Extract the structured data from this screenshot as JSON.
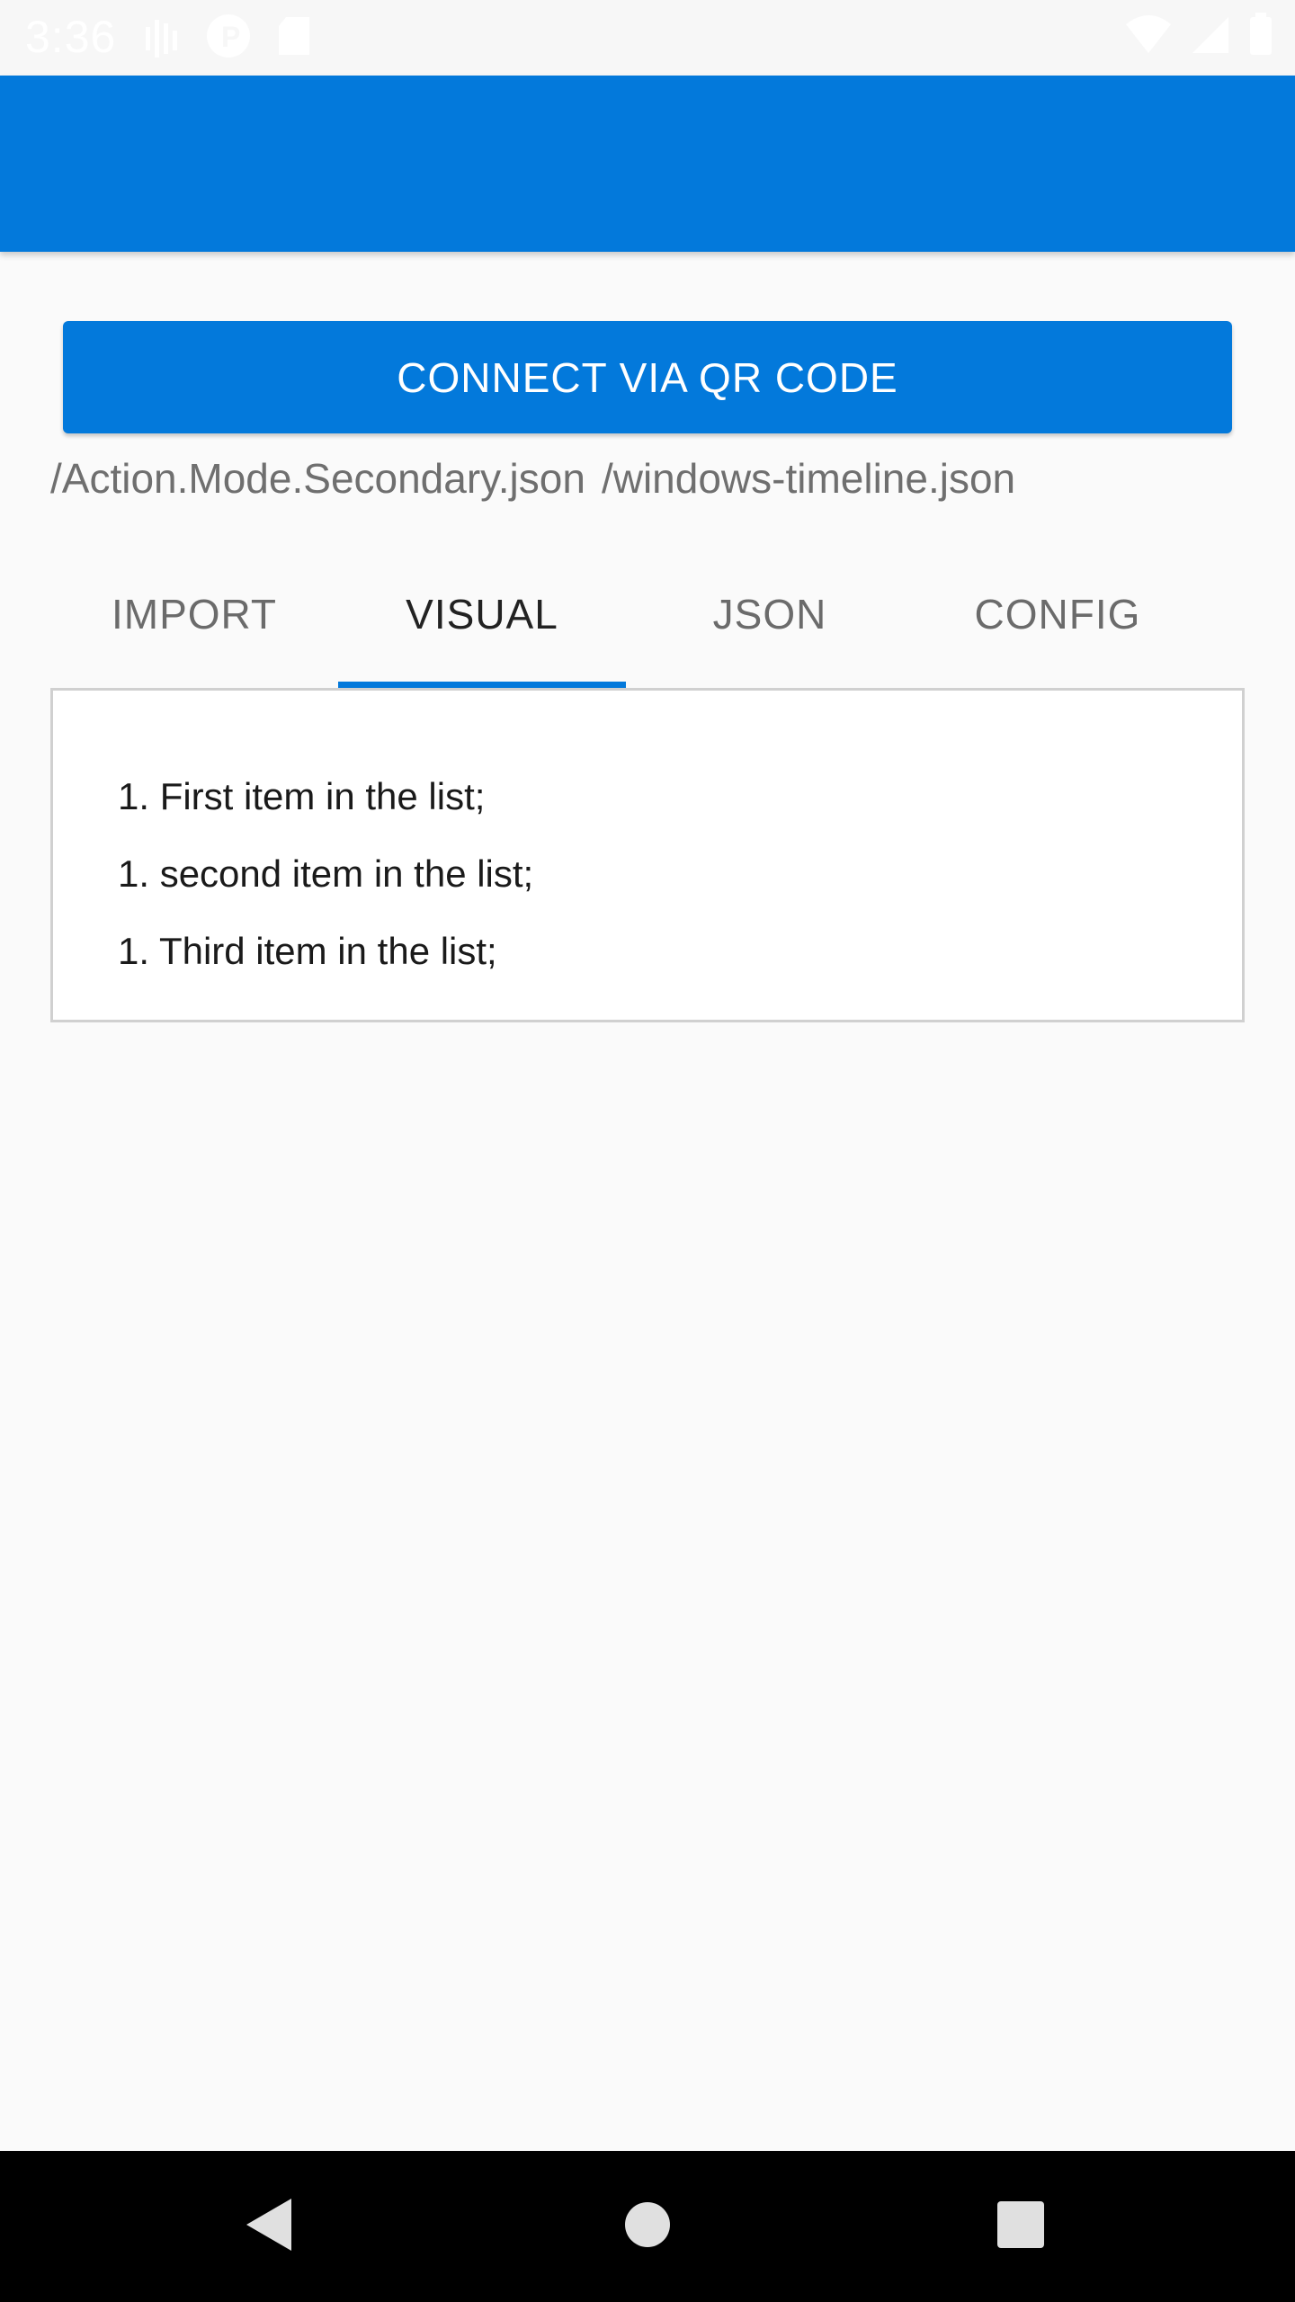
{
  "status_bar": {
    "time": "3:36",
    "icons_left": [
      "signal-bars-icon",
      "p-badge-icon",
      "sd-card-icon"
    ],
    "icons_right": [
      "wifi-icon",
      "cell-signal-icon",
      "battery-icon"
    ]
  },
  "app_bar": {
    "color": "#0379db"
  },
  "connect_button": {
    "label": "CONNECT VIA QR CODE",
    "color": "#0379db"
  },
  "paths": [
    "/Action.Mode.Secondary.json",
    "/windows-timeline.json"
  ],
  "tabs": [
    {
      "label": "IMPORT",
      "active": false
    },
    {
      "label": "VISUAL",
      "active": true
    },
    {
      "label": "JSON",
      "active": false
    },
    {
      "label": "CONFIG",
      "active": false
    }
  ],
  "list_items": [
    "1. First item in the list;",
    "1. second item in the list;",
    "1. Third item in the list;"
  ],
  "nav_bar": {
    "buttons": [
      "back-icon",
      "home-icon",
      "recents-icon"
    ]
  }
}
